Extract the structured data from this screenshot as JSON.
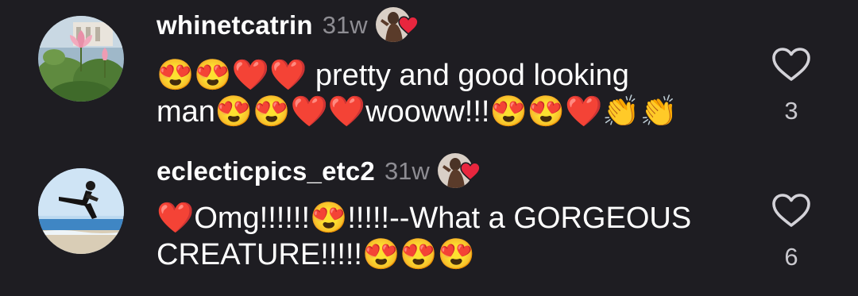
{
  "comments": [
    {
      "username": "whinetcatrin",
      "time": "31w",
      "text_line1": "😍😍❤️❤️ pretty and good looking",
      "text_line2": "man😍😍❤️❤️wooww!!!😍😍❤️👏👏",
      "likes": "3",
      "avatar_icon": "lotus-flower-photo",
      "liked_by_author": true
    },
    {
      "username": "eclecticpics_etc2",
      "time": "31w",
      "text_line1": "❤️Omg!!!!!!😍!!!!!--What a GORGEOUS",
      "text_line2": "CREATURE!!!!!😍😍😍",
      "likes": "6",
      "avatar_icon": "martial-arts-kick-photo",
      "liked_by_author": true
    }
  ],
  "colors": {
    "background": "#1e1d22",
    "username": "#ffffff",
    "timestamp": "#8e8d93",
    "like_count": "#c9c8ce",
    "heart_badge": "#e8263e"
  }
}
